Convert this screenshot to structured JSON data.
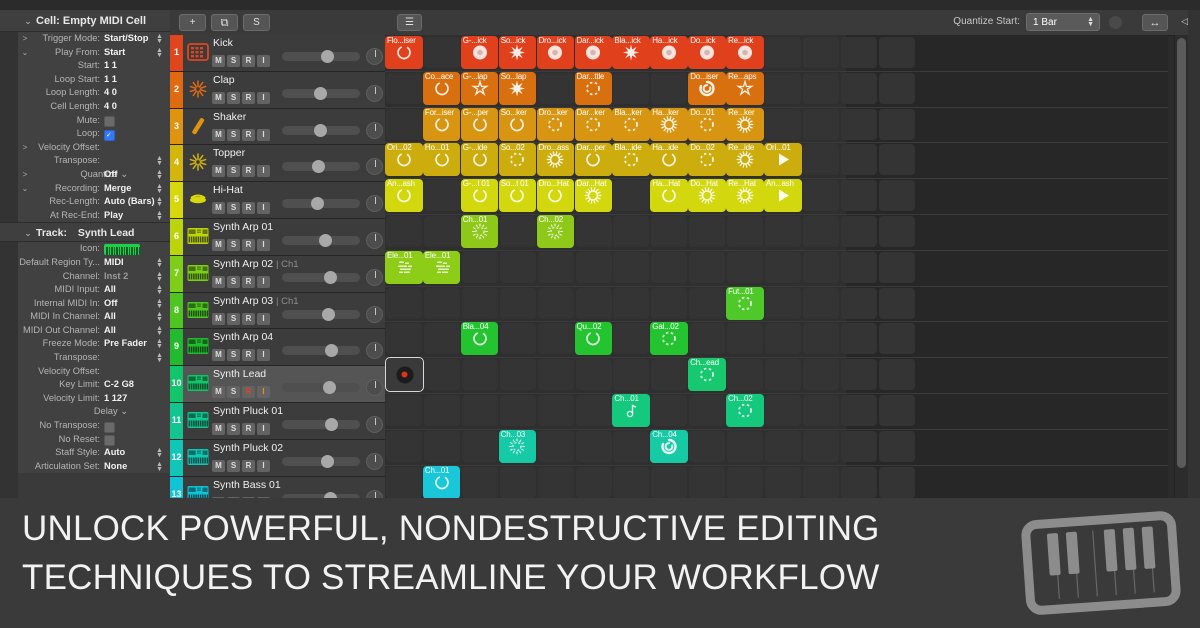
{
  "inspector": {
    "cell_header": {
      "twisty": "⌄",
      "title": "Cell: Empty MIDI Cell"
    },
    "cell_rows": [
      {
        "twisty": ">",
        "label": "Trigger Mode:",
        "value": "Start/Stop",
        "stepper": true
      },
      {
        "twisty": "⌄",
        "label": "Play From:",
        "value": "Start",
        "stepper": true
      },
      {
        "twisty": "",
        "label": "Start:",
        "value": "1  1",
        "stepper": false
      },
      {
        "twisty": "",
        "label": "Loop Start:",
        "value": "1  1",
        "stepper": false
      },
      {
        "twisty": "",
        "label": "Loop Length:",
        "value": "4  0",
        "stepper": false
      },
      {
        "twisty": "",
        "label": "Cell Length:",
        "value": "4  0",
        "stepper": false
      },
      {
        "twisty": "",
        "label": "Mute:",
        "value": "",
        "checkbox": "off"
      },
      {
        "twisty": "",
        "label": "Loop:",
        "value": "",
        "checkbox": "on"
      },
      {
        "twisty": ">",
        "label": "Velocity Offset:",
        "value": "",
        "stepper": false
      },
      {
        "twisty": "",
        "label": "Transpose:",
        "value": "",
        "stepper": true
      },
      {
        "twisty": ">",
        "label": "Quantize ⌄",
        "value": "Off",
        "stepper": true,
        "centered": true
      },
      {
        "twisty": "⌄",
        "label": "Recording:",
        "value": "Merge",
        "stepper": true
      },
      {
        "twisty": "",
        "label": "Rec-Length:",
        "value": "Auto (Bars)",
        "stepper": true
      },
      {
        "twisty": "",
        "label": "At Rec-End:",
        "value": "Play",
        "stepper": true
      }
    ],
    "track_header": {
      "twisty": "⌄",
      "title": "Track:",
      "value": "Synth Lead"
    },
    "track_rows": [
      {
        "label": "Icon:",
        "value": "",
        "icon": "synth-keyboard-icon"
      },
      {
        "label": "Default Region Ty...",
        "value": "MIDI",
        "stepper": true
      },
      {
        "label": "Channel:",
        "value": "Inst 2",
        "stepper": true,
        "dim": true
      },
      {
        "label": "MIDI Input:",
        "value": "All",
        "stepper": true
      },
      {
        "label": "Internal MIDI In:",
        "value": "Off",
        "stepper": true
      },
      {
        "label": "MIDI In Channel:",
        "value": "All",
        "stepper": true
      },
      {
        "label": "MIDI Out Channel:",
        "value": "All",
        "stepper": true
      },
      {
        "label": "Freeze Mode:",
        "value": "Pre Fader",
        "stepper": true
      },
      {
        "label": "Transpose:",
        "value": "",
        "stepper": true
      },
      {
        "label": "Velocity Offset:",
        "value": "",
        "stepper": false
      },
      {
        "label": "Key Limit:",
        "value": "C-2  G8",
        "stepper": false
      },
      {
        "label": "Velocity Limit:",
        "value": "1   127",
        "stepper": false
      },
      {
        "label": "Delay ⌄",
        "value": "",
        "stepper": false,
        "centered": true
      },
      {
        "label": "No Transpose:",
        "value": "",
        "checkbox": "off"
      },
      {
        "label": "No Reset:",
        "value": "",
        "checkbox": "off"
      },
      {
        "label": "Staff Style:",
        "value": "Auto",
        "stepper": true
      },
      {
        "label": "Articulation Set:",
        "value": "None",
        "stepper": true
      }
    ]
  },
  "toolbar": {
    "add_label": "+",
    "duplicate_label": "⧉",
    "solo_label": "S",
    "view_label": "☰",
    "quantize_label": "Quantize Start:",
    "quantize_value": "1 Bar",
    "resize_label": "↔",
    "panel_label": "◁▶"
  },
  "tracks": [
    {
      "num": "1",
      "name": "Kick",
      "channel": "",
      "color": "#e0461e",
      "icon": "drum-machine-icon",
      "fader": 0.58,
      "selected": false
    },
    {
      "num": "2",
      "name": "Clap",
      "channel": "",
      "color": "#e06a12",
      "icon": "burst-icon",
      "fader": 0.47,
      "selected": false
    },
    {
      "num": "3",
      "name": "Shaker",
      "channel": "",
      "color": "#e0930f",
      "icon": "stick-icon",
      "fader": 0.47,
      "selected": false
    },
    {
      "num": "4",
      "name": "Topper",
      "channel": "",
      "color": "#d3b50c",
      "icon": "burst-icon",
      "fader": 0.44,
      "selected": false
    },
    {
      "num": "5",
      "name": "Hi-Hat",
      "channel": "",
      "color": "#d7d70d",
      "icon": "hihat-icon",
      "fader": 0.43,
      "selected": false
    },
    {
      "num": "6",
      "name": "Synth Arp 01",
      "channel": "",
      "color": "#bcd40c",
      "icon": "synth-keyboard-icon",
      "fader": 0.55,
      "selected": false
    },
    {
      "num": "7",
      "name": "Synth Arp 02",
      "channel": "Ch1",
      "color": "#7ece19",
      "icon": "synth-keyboard-icon",
      "fader": 0.63,
      "selected": false
    },
    {
      "num": "8",
      "name": "Synth Arp 03",
      "channel": "Ch1",
      "color": "#4fc522",
      "icon": "synth-keyboard-icon",
      "fader": 0.61,
      "selected": false
    },
    {
      "num": "9",
      "name": "Synth Arp 04",
      "channel": "",
      "color": "#22bb2f",
      "icon": "synth-keyboard-icon",
      "fader": 0.65,
      "selected": false
    },
    {
      "num": "10",
      "name": "Synth Lead",
      "channel": "",
      "color": "#12c46a",
      "icon": "synth-keyboard-icon",
      "fader": 0.62,
      "selected": true
    },
    {
      "num": "11",
      "name": "Synth Pluck 01",
      "channel": "",
      "color": "#11c490",
      "icon": "synth-keyboard-icon",
      "fader": 0.65,
      "selected": false
    },
    {
      "num": "12",
      "name": "Synth Pluck 02",
      "channel": "",
      "color": "#10c6b6",
      "icon": "synth-keyboard-icon",
      "fader": 0.59,
      "selected": false
    },
    {
      "num": "13",
      "name": "Synth Bass 01",
      "channel": "",
      "color": "#10c3d6",
      "icon": "synth-keyboard-icon",
      "fader": 0.63,
      "selected": false
    }
  ],
  "track_button_labels": {
    "mute": "M",
    "solo": "S",
    "record": "R",
    "input": "I"
  },
  "grid": {
    "columns": 11,
    "scene_break_after": 2,
    "cells": [
      {
        "row": 0,
        "col": 0,
        "label": "Flo...iser",
        "color": "#e0401c",
        "glyph": "ring"
      },
      {
        "row": 0,
        "col": 2,
        "label": "G-...ick",
        "color": "#e0401c",
        "glyph": "donut"
      },
      {
        "row": 0,
        "col": 3,
        "label": "So...ick",
        "color": "#e0401c",
        "glyph": "star"
      },
      {
        "row": 0,
        "col": 4,
        "label": "Dro...ick",
        "color": "#e0401c",
        "glyph": "donut"
      },
      {
        "row": 0,
        "col": 5,
        "label": "Dar...ick",
        "color": "#e0401c",
        "glyph": "donut"
      },
      {
        "row": 0,
        "col": 6,
        "label": "Bla...ick",
        "color": "#e0401c",
        "glyph": "star"
      },
      {
        "row": 0,
        "col": 7,
        "label": "Ha...ick",
        "color": "#e0401c",
        "glyph": "donut"
      },
      {
        "row": 0,
        "col": 8,
        "label": "Do...ick",
        "color": "#e0401c",
        "glyph": "donut"
      },
      {
        "row": 0,
        "col": 9,
        "label": "Re...ick",
        "color": "#e0401c",
        "glyph": "donut"
      },
      {
        "row": 1,
        "col": 1,
        "label": "Co...ace",
        "color": "#d9700f",
        "glyph": "ring"
      },
      {
        "row": 1,
        "col": 2,
        "label": "G-...lap",
        "color": "#d9700f",
        "glyph": "spark"
      },
      {
        "row": 1,
        "col": 3,
        "label": "So...lap",
        "color": "#d9700f",
        "glyph": "star"
      },
      {
        "row": 1,
        "col": 5,
        "label": "Dar...ttle",
        "color": "#d9700f",
        "glyph": "dotring"
      },
      {
        "row": 1,
        "col": 8,
        "label": "Do...iser",
        "color": "#d9700f",
        "glyph": "swirl"
      },
      {
        "row": 1,
        "col": 9,
        "label": "Re...aps",
        "color": "#d9700f",
        "glyph": "spark"
      },
      {
        "row": 2,
        "col": 1,
        "label": "For...iser",
        "color": "#d79512",
        "glyph": "ring"
      },
      {
        "row": 2,
        "col": 2,
        "label": "G-...per",
        "color": "#d79512",
        "glyph": "ring"
      },
      {
        "row": 2,
        "col": 3,
        "label": "So...ker",
        "color": "#d79512",
        "glyph": "ring"
      },
      {
        "row": 2,
        "col": 4,
        "label": "Dro...ker",
        "color": "#d79512",
        "glyph": "dotring"
      },
      {
        "row": 2,
        "col": 5,
        "label": "Dar...ker",
        "color": "#d79512",
        "glyph": "dotring"
      },
      {
        "row": 2,
        "col": 6,
        "label": "Bla...ker",
        "color": "#d79512",
        "glyph": "dotring"
      },
      {
        "row": 2,
        "col": 7,
        "label": "Ha...ker",
        "color": "#d79512",
        "glyph": "sun"
      },
      {
        "row": 2,
        "col": 8,
        "label": "Do...01",
        "color": "#d79512",
        "glyph": "dotring"
      },
      {
        "row": 2,
        "col": 9,
        "label": "Re...ker",
        "color": "#d79512",
        "glyph": "sun"
      },
      {
        "row": 3,
        "col": 0,
        "label": "Ori...02",
        "color": "#ccad0d",
        "glyph": "ring"
      },
      {
        "row": 3,
        "col": 1,
        "label": "Ho...01",
        "color": "#ccad0d",
        "glyph": "ring"
      },
      {
        "row": 3,
        "col": 2,
        "label": "G-...ide",
        "color": "#ccad0d",
        "glyph": "ring"
      },
      {
        "row": 3,
        "col": 3,
        "label": "So...02",
        "color": "#ccad0d",
        "glyph": "dotring"
      },
      {
        "row": 3,
        "col": 4,
        "label": "Dro...ass",
        "color": "#ccad0d",
        "glyph": "sun"
      },
      {
        "row": 3,
        "col": 5,
        "label": "Dar...per",
        "color": "#ccad0d",
        "glyph": "ring"
      },
      {
        "row": 3,
        "col": 6,
        "label": "Bla...ide",
        "color": "#ccad0d",
        "glyph": "dotring"
      },
      {
        "row": 3,
        "col": 7,
        "label": "Ha...ide",
        "color": "#ccad0d",
        "glyph": "ring"
      },
      {
        "row": 3,
        "col": 8,
        "label": "Do...02",
        "color": "#ccad0d",
        "glyph": "dotring"
      },
      {
        "row": 3,
        "col": 9,
        "label": "Re...ide",
        "color": "#ccad0d",
        "glyph": "sun"
      },
      {
        "row": 3,
        "col": 10,
        "label": "Ori...01",
        "color": "#ccad0d",
        "glyph": "play"
      },
      {
        "row": 4,
        "col": 0,
        "label": "An...ash",
        "color": "#d3d70e",
        "glyph": "ring"
      },
      {
        "row": 4,
        "col": 2,
        "label": "G-...t 01",
        "color": "#d3d70e",
        "glyph": "ring"
      },
      {
        "row": 4,
        "col": 3,
        "label": "So...t 01",
        "color": "#d3d70e",
        "glyph": "ring"
      },
      {
        "row": 4,
        "col": 4,
        "label": "Dro...Hat",
        "color": "#d3d70e",
        "glyph": "ring"
      },
      {
        "row": 4,
        "col": 5,
        "label": "Dar...Hat",
        "color": "#d3d70e",
        "glyph": "sun"
      },
      {
        "row": 4,
        "col": 7,
        "label": "Ha...Hat",
        "color": "#d3d70e",
        "glyph": "ring"
      },
      {
        "row": 4,
        "col": 8,
        "label": "Do...Hat",
        "color": "#d3d70e",
        "glyph": "sun"
      },
      {
        "row": 4,
        "col": 9,
        "label": "Re...Hat",
        "color": "#d3d70e",
        "glyph": "sun"
      },
      {
        "row": 4,
        "col": 10,
        "label": "An...ash",
        "color": "#d3d70e",
        "glyph": "play"
      },
      {
        "row": 5,
        "col": 2,
        "label": "Ch...01",
        "color": "#8ec91a",
        "glyph": "dotsun"
      },
      {
        "row": 5,
        "col": 4,
        "label": "Ch...02",
        "color": "#8ec91a",
        "glyph": "dotsun"
      },
      {
        "row": 6,
        "col": 0,
        "label": "Ele...01",
        "color": "#8ecd17",
        "glyph": "notes"
      },
      {
        "row": 6,
        "col": 1,
        "label": "Ele...01",
        "color": "#8ecd17",
        "glyph": "notes"
      },
      {
        "row": 7,
        "col": 9,
        "label": "Fut...01",
        "color": "#4fc92a",
        "glyph": "dotring"
      },
      {
        "row": 8,
        "col": 2,
        "label": "Bla...04",
        "color": "#24c431",
        "glyph": "ring"
      },
      {
        "row": 8,
        "col": 5,
        "label": "Qu...02",
        "color": "#24c431",
        "glyph": "ring"
      },
      {
        "row": 8,
        "col": 7,
        "label": "Gal...02",
        "color": "#24c431",
        "glyph": "dotring"
      },
      {
        "row": 9,
        "col": 8,
        "label": "Ch...ead",
        "color": "#18c86f",
        "glyph": "dotring"
      },
      {
        "row": 10,
        "col": 6,
        "label": "Ch...01",
        "color": "#14c97e",
        "glyph": "note"
      },
      {
        "row": 10,
        "col": 9,
        "label": "Ch...02",
        "color": "#14c97e",
        "glyph": "dotring"
      },
      {
        "row": 11,
        "col": 3,
        "label": "Ch...03",
        "color": "#16caa6",
        "glyph": "dotsun"
      },
      {
        "row": 11,
        "col": 7,
        "label": "Ch...04",
        "color": "#16caa6",
        "glyph": "swirl"
      },
      {
        "row": 12,
        "col": 1,
        "label": "Ch...01",
        "color": "#19c7d8",
        "glyph": "ring"
      }
    ],
    "selected_cell": {
      "row": 9,
      "col": 0,
      "state": "record-armed"
    }
  },
  "banner": {
    "line1": "UNLOCK POWERFUL, NONDESTRUCTIVE EDITING",
    "line2": "TECHNIQUES TO STREAMLINE YOUR WORKFLOW",
    "logo": "piano-keyboard-icon"
  },
  "colors": {
    "window_bg": "#2b2b2b",
    "banner_bg": "#3a3a3a",
    "inspector_bg": "#414141",
    "accent_record": "#e0301e",
    "accent_check": "#3478f6",
    "text_primary": "#f2f2f2"
  }
}
